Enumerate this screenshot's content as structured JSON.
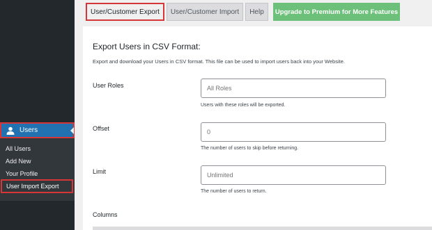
{
  "sidebar": {
    "menu_users_label": "Users",
    "items": [
      {
        "label": "All Users"
      },
      {
        "label": "Add New"
      },
      {
        "label": "Your Profile"
      },
      {
        "label": "User Import Export"
      }
    ]
  },
  "tabs": [
    {
      "label": "User/Customer Export"
    },
    {
      "label": "User/Customer Import"
    },
    {
      "label": "Help"
    },
    {
      "label": "Upgrade to Premium for More Features"
    }
  ],
  "export": {
    "title": "Export Users in CSV Format:",
    "description": "Export and download your Users in CSV format. This file can be used to import users back into your Website.",
    "user_roles": {
      "label": "User Roles",
      "placeholder": "All Roles",
      "hint": "Users with these roles will be exported."
    },
    "offset": {
      "label": "Offset",
      "placeholder": "0",
      "hint": "The number of users to skip before returning."
    },
    "limit": {
      "label": "Limit",
      "placeholder": "Unlimited",
      "hint": "The number of users to return."
    },
    "columns_label": "Columns"
  },
  "colors": {
    "sidebar_bg": "#23282d",
    "submenu_bg": "#32373c",
    "menu_active": "#2271b1",
    "highlight_border": "#d63638",
    "premium_green": "#6cc07a"
  },
  "icons": {
    "users_menu": "user-icon"
  }
}
